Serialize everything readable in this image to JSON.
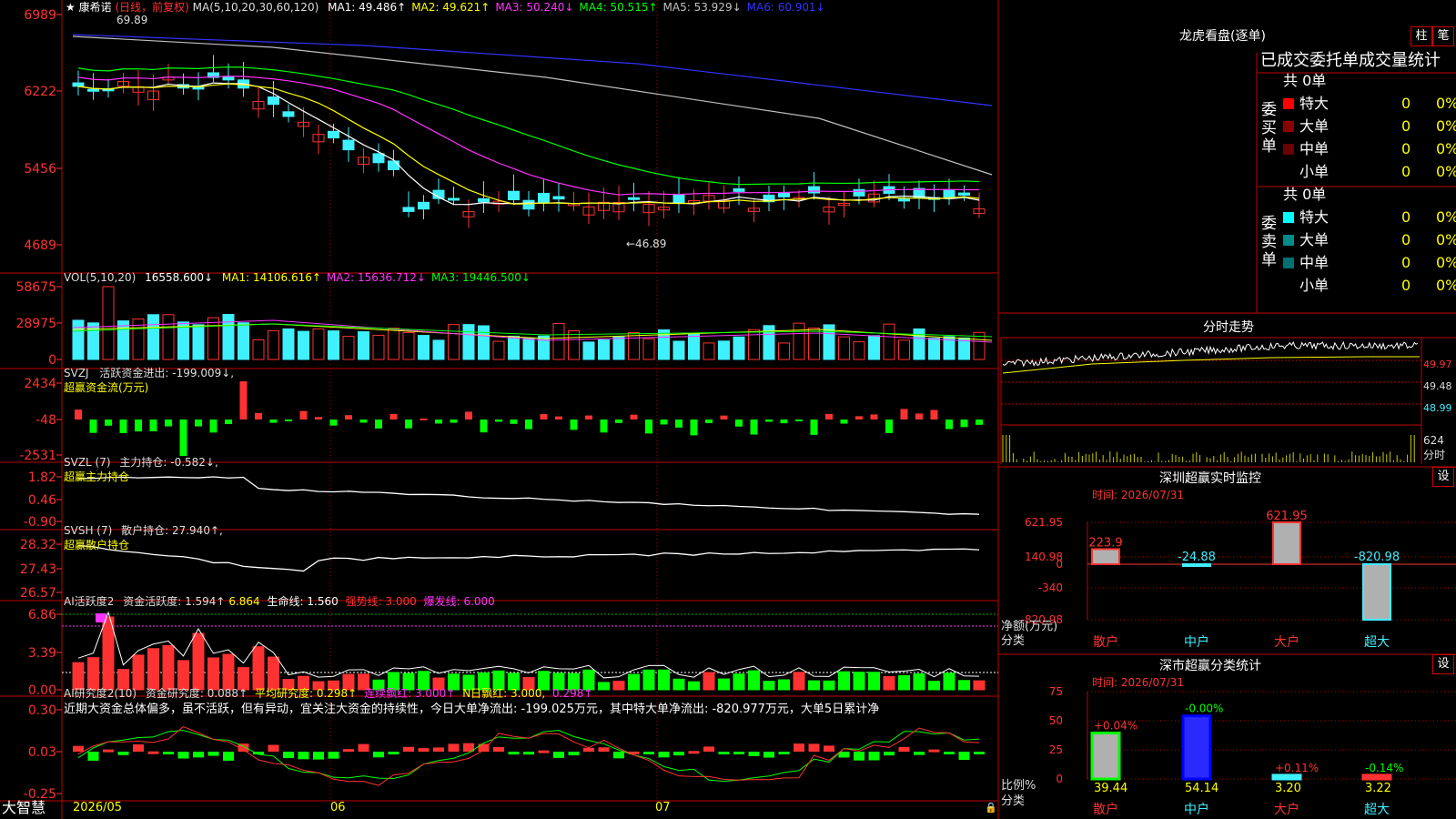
{
  "colors": {
    "up": "#ff3232",
    "down": "#3ff0ff",
    "frame": "#c00000",
    "text": "#dddddd",
    "ma5": "#ffffff",
    "ma10": "#ffff00",
    "ma20": "#ff33ff",
    "ma30": "#00ff00",
    "ma60": "#c0c0c0",
    "ma120": "#3333ff"
  },
  "main": {
    "stock_name": "康希诺",
    "mode": "(日线，前复权)",
    "ma_title": "MA(5,10,20,30,60,120)",
    "ma": [
      {
        "label": "MA1: 49.486↑",
        "color": "#ffffff"
      },
      {
        "label": "MA2: 49.621↑",
        "color": "#ffff00"
      },
      {
        "label": "MA3: 50.240↓",
        "color": "#ff33ff"
      },
      {
        "label": "MA4: 50.515↑",
        "color": "#00ff00"
      },
      {
        "label": "MA5: 53.929↓",
        "color": "#c0c0c0"
      },
      {
        "label": "MA6: 60.901↓",
        "color": "#3333ff"
      }
    ],
    "y_labels": [
      "6989",
      "6222",
      "5456",
      "4689"
    ],
    "high_label": "69.89",
    "low_label": "←46.89"
  },
  "vol": {
    "title": "VOL(5,10,20)",
    "value": "16558.600↓",
    "ma": [
      {
        "label": "MA1: 14106.616↑",
        "color": "#ffff00"
      },
      {
        "label": "MA2: 15636.712↓",
        "color": "#ff33ff"
      },
      {
        "label": "MA3: 19446.500↓",
        "color": "#00ff00"
      }
    ],
    "y_labels": [
      "58675",
      "28975",
      "0"
    ]
  },
  "svzj": {
    "title": "SVZJ",
    "desc": "活跃资金进出: -199.009↓,",
    "sub": "超赢资金流(万元)",
    "y_labels": [
      "2434",
      "-48",
      "-2531"
    ]
  },
  "svzl": {
    "title": "SVZL (7)",
    "desc": "主力持仓: -0.582↓,",
    "sub": "超赢主力持仓",
    "y_labels": [
      "1.82",
      "0.46",
      "-0.90"
    ]
  },
  "svsh": {
    "title": "SVSH (7)",
    "desc": "散户持仓: 27.940↑,",
    "sub": "超赢散户持仓",
    "y_labels": [
      "28.32",
      "27.43",
      "26.57"
    ]
  },
  "ai1": {
    "title": "AI活跃度2",
    "desc": "资金活跃度: 1.594↑",
    "v2": "6.864",
    "life": "生命线: 1.560",
    "strong": "强势线: 3.000",
    "burst": "爆发线: 6.000",
    "y_labels": [
      "6.86",
      "3.39",
      "0.00"
    ]
  },
  "ai2": {
    "title": "AI研究度2(10)",
    "desc": "资金研究度: 0.088↑",
    "avg": "平均研究度: 0.298↑",
    "lianxu": "连续飘红: 3.000↑",
    "nday": "N日飘红: 3.000,",
    "v": "0.298↑",
    "y_labels": [
      "0.30",
      "0.03",
      "-0.25"
    ],
    "comment": "近期大资金总体偏多，虽不活跃，但有异动，宜关注大资金的持续性，今日大单净流出: -199.025万元，其中特大单净流出: -820.977万元，大单5日累计净"
  },
  "footer": {
    "brand": "大智慧",
    "dates": [
      "2026/05",
      "06",
      "07"
    ]
  },
  "panel": {
    "title": "龙虎看盘(逐单)",
    "btn1": "柱",
    "btn2": "笔",
    "header": "已成交委托单成交量统计",
    "buy": {
      "side": [
        "委",
        "买",
        "单"
      ],
      "total": "共 0单",
      "rows": [
        {
          "label": "特大",
          "count": "0",
          "pct": "0%",
          "color": "#ff0000"
        },
        {
          "label": "大单",
          "count": "0",
          "pct": "0%",
          "color": "#8b0000"
        },
        {
          "label": "中单",
          "count": "0",
          "pct": "0%",
          "color": "#6b0000"
        },
        {
          "label": "小单",
          "count": "0",
          "pct": "0%",
          "color": ""
        }
      ]
    },
    "sell": {
      "side": [
        "委",
        "卖",
        "单"
      ],
      "total": "共 0单",
      "rows": [
        {
          "label": "特大",
          "count": "0",
          "pct": "0%",
          "color": "#00ffff"
        },
        {
          "label": "大单",
          "count": "0",
          "pct": "0%",
          "color": "#008b8b"
        },
        {
          "label": "中单",
          "count": "0",
          "pct": "0%",
          "color": "#007070"
        },
        {
          "label": "小单",
          "count": "0",
          "pct": "0%",
          "color": ""
        }
      ]
    }
  },
  "minute": {
    "title": "分时走势",
    "y_labels": [
      "49.97",
      "49.48",
      "48.99"
    ],
    "vol_label": "624",
    "vol_sub": "分时"
  },
  "sz_monitor": {
    "title": "深圳超赢实时监控",
    "btn": "设",
    "time": "时间: 2026/07/31",
    "y_labels": [
      "621.95",
      "140.98",
      "0",
      "-340",
      "-820.98"
    ],
    "bars": [
      {
        "cat": "散户",
        "value": 223.9,
        "label": "223.9"
      },
      {
        "cat": "中户",
        "value": -24.88,
        "label": "-24.88"
      },
      {
        "cat": "大户",
        "value": 621.95,
        "label": "621.95"
      },
      {
        "cat": "超大",
        "value": -820.98,
        "label": "-820.98"
      }
    ],
    "ylabel": "净额(万元)",
    "xlabel": "分类"
  },
  "sz_stats": {
    "title": "深市超赢分类统计",
    "btn": "设",
    "time": "时间: 2026/07/31",
    "y_labels": [
      "75",
      "50",
      "25",
      "0"
    ],
    "bars": [
      {
        "cat": "散户",
        "value": 39.44,
        "label": "39.44",
        "change": "+0.04%"
      },
      {
        "cat": "中户",
        "value": 54.14,
        "label": "54.14",
        "change": "-0.00%"
      },
      {
        "cat": "大户",
        "value": 3.2,
        "label": "3.20",
        "change": "+0.11%"
      },
      {
        "cat": "超大",
        "value": 3.22,
        "label": "3.22",
        "change": "-0.14%"
      }
    ],
    "ylabel": "比例%",
    "xlabel": "分类"
  }
}
